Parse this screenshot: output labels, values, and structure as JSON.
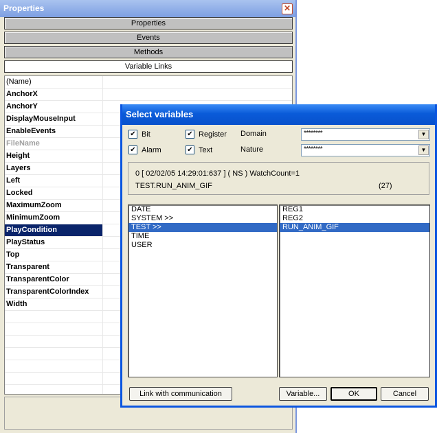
{
  "properties": {
    "title": "Properties",
    "close_glyph": "✕",
    "tabs": [
      {
        "label": "Properties",
        "active": false
      },
      {
        "label": "Events",
        "active": false
      },
      {
        "label": "Methods",
        "active": false
      },
      {
        "label": "Variable Links",
        "active": true
      }
    ],
    "rows": [
      {
        "name": "(Name)",
        "style": "plain"
      },
      {
        "name": "AnchorX",
        "style": "bold"
      },
      {
        "name": "AnchorY",
        "style": "bold"
      },
      {
        "name": "DisplayMouseInput",
        "style": "bold"
      },
      {
        "name": "EnableEvents",
        "style": "bold"
      },
      {
        "name": "FileName",
        "style": "disabled"
      },
      {
        "name": "Height",
        "style": "bold"
      },
      {
        "name": "Layers",
        "style": "bold"
      },
      {
        "name": "Left",
        "style": "bold"
      },
      {
        "name": "Locked",
        "style": "bold"
      },
      {
        "name": "MaximumZoom",
        "style": "bold"
      },
      {
        "name": "MinimumZoom",
        "style": "bold"
      },
      {
        "name": "PlayCondition",
        "style": "selected"
      },
      {
        "name": "PlayStatus",
        "style": "bold"
      },
      {
        "name": "Top",
        "style": "bold"
      },
      {
        "name": "Transparent",
        "style": "bold"
      },
      {
        "name": "TransparentColor",
        "style": "bold"
      },
      {
        "name": "TransparentColorIndex",
        "style": "bold"
      },
      {
        "name": "Width",
        "style": "bold"
      }
    ],
    "empty_rows": 8
  },
  "dialog": {
    "title": "Select variables",
    "filters": {
      "bit": {
        "label": "Bit",
        "checked": true
      },
      "alarm": {
        "label": "Alarm",
        "checked": true
      },
      "register": {
        "label": "Register",
        "checked": true
      },
      "text": {
        "label": "Text",
        "checked": true
      }
    },
    "domain_label": "Domain",
    "domain_value": "********",
    "nature_label": "Nature",
    "nature_value": "********",
    "info": {
      "line1": "0 [ 02/02/05 14:29:01:637 ]  ( NS ) WatchCount=1",
      "line2": "TEST.RUN_ANIM_GIF",
      "count": "(27)"
    },
    "domains_list": [
      {
        "label": "DATE",
        "selected": false
      },
      {
        "label": "SYSTEM >>",
        "selected": false
      },
      {
        "label": "TEST >>",
        "selected": true
      },
      {
        "label": "TIME",
        "selected": false
      },
      {
        "label": "USER",
        "selected": false
      }
    ],
    "variables_list": [
      {
        "label": "REG1",
        "selected": false
      },
      {
        "label": "REG2",
        "selected": false
      },
      {
        "label": "RUN_ANIM_GIF",
        "selected": true
      }
    ],
    "buttons": {
      "link": "Link with communication",
      "variable": "Variable...",
      "ok": "OK",
      "cancel": "Cancel"
    },
    "check_glyph": "✔",
    "dropdown_glyph": "▼"
  },
  "colors": {
    "selection_dark": "#0a246a",
    "selection_list": "#316ac5",
    "dialog_title": "#0a5bd9",
    "window_bg": "#ece9d8"
  }
}
